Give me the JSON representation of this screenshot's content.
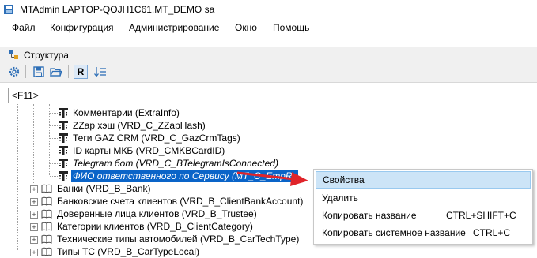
{
  "window": {
    "title": "MTAdmin LAPTOP-QOJH1C61.MT_DEMO sa"
  },
  "menu": {
    "items": [
      "Файл",
      "Конфигурация",
      "Администрирование",
      "Окно",
      "Помощь"
    ]
  },
  "panel": {
    "title": "Структура"
  },
  "toolbar": {
    "r_label": "R"
  },
  "filter": {
    "value": "<F11>"
  },
  "tree": {
    "children": [
      {
        "label": "Комментарии (ExtraInfo)"
      },
      {
        "label": "ZZap хэш (VRD_C_ZZapHash)"
      },
      {
        "label": "Теги GAZ CRM (VRD_C_GazCrmTags)"
      },
      {
        "label": "ID карты МКБ (VRD_CMKBCardID)"
      },
      {
        "label": "Telegram бот (VRD_C_BTelegramIsConnected)"
      },
      {
        "label": "ФИО ответственного по Сервису (MT_C_EmpR..."
      }
    ],
    "groups": [
      {
        "label": "Банки (VRD_B_Bank)"
      },
      {
        "label": "Банковские счета клиентов (VRD_B_ClientBankAccount)"
      },
      {
        "label": "Доверенные лица клиентов (VRD_B_Trustee)"
      },
      {
        "label": "Категории клиентов (VRD_B_ClientCategory)"
      },
      {
        "label": "Технические типы автомобилей (VRD_B_CarTechType)"
      },
      {
        "label": "Типы ТС (VRD_B_CarTypeLocal)"
      }
    ]
  },
  "context_menu": {
    "items": [
      {
        "label": "Свойства",
        "shortcut": ""
      },
      {
        "label": "Удалить",
        "shortcut": ""
      },
      {
        "label": "Копировать название",
        "shortcut": "CTRL+SHIFT+C"
      },
      {
        "label": "Копировать системное название",
        "shortcut": "CTRL+C"
      }
    ]
  },
  "colors": {
    "selection": "#0a64c8",
    "arrow": "#e0242a",
    "hover": "#cce4f7"
  }
}
